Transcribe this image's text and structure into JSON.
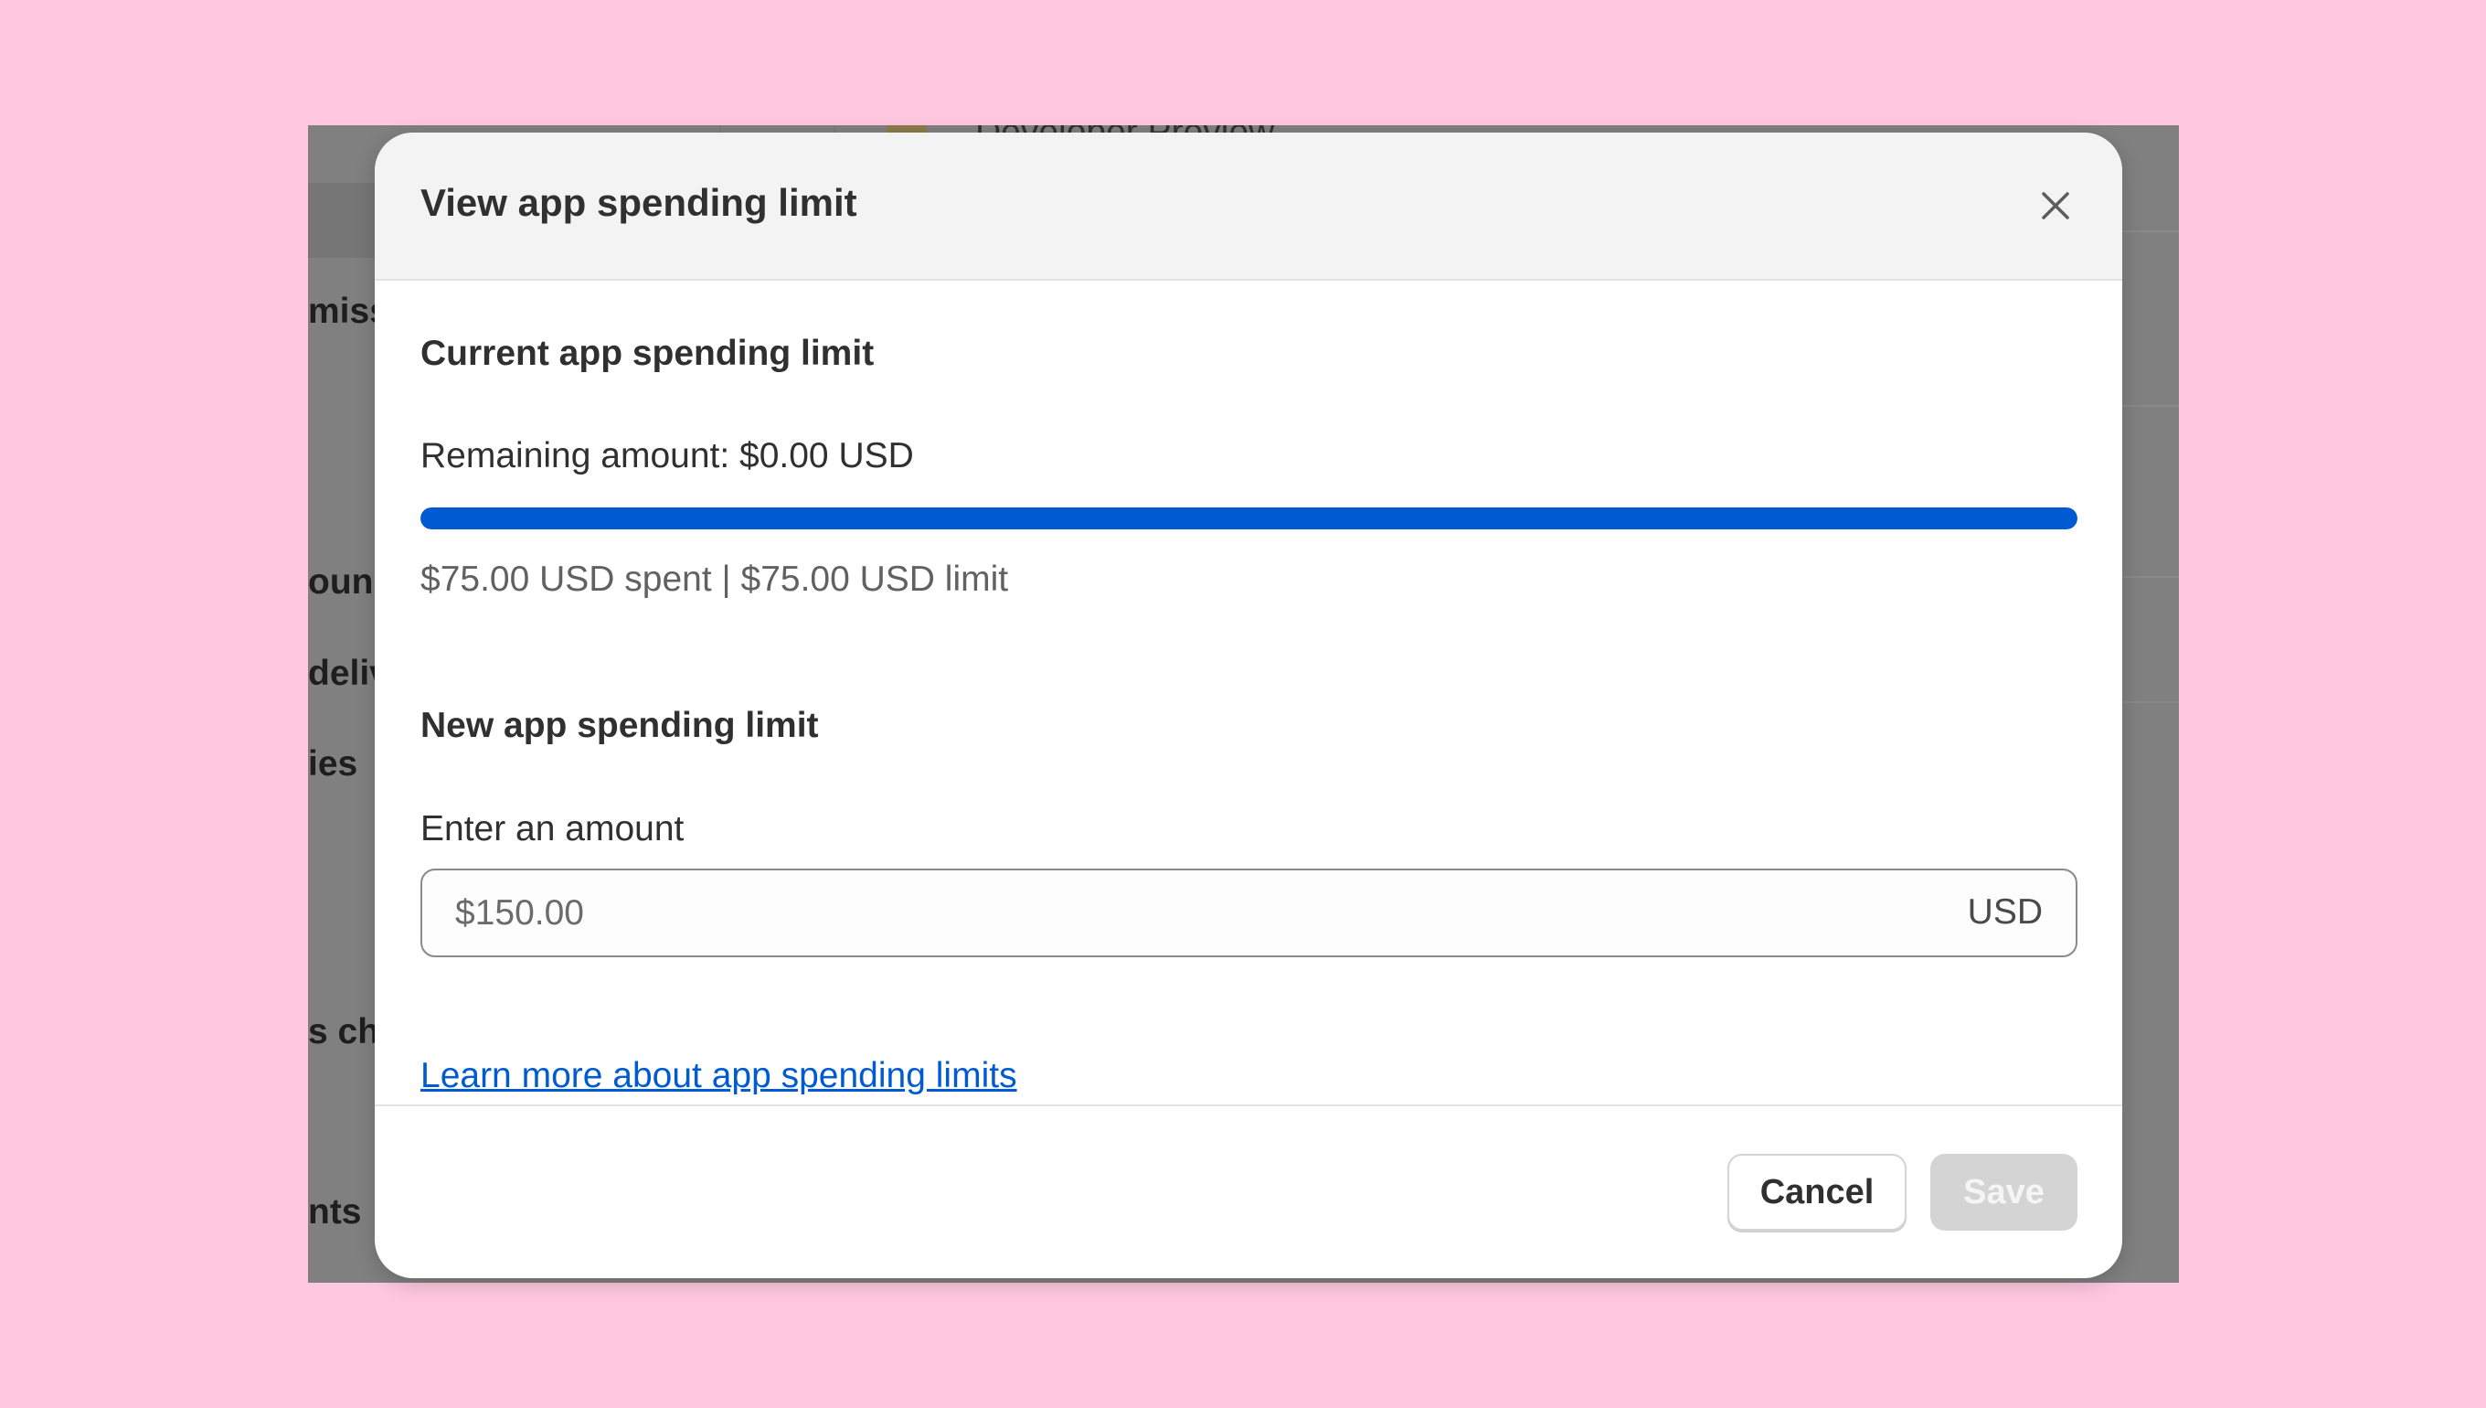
{
  "background_page": {
    "top_text": "Developer Preview",
    "left_fragments": [
      "miss",
      "oun",
      "deliv",
      "ies",
      "s ch",
      "nts"
    ]
  },
  "modal": {
    "title": "View app spending limit",
    "close_icon": "close-icon",
    "current": {
      "heading": "Current app spending limit",
      "remaining": "Remaining amount: $0.00 USD",
      "progress_fraction": 1.0,
      "spent_summary": "$75.00 USD spent | $75.00 USD limit"
    },
    "new_limit": {
      "heading": "New app spending limit",
      "field_label": "Enter an amount",
      "placeholder": "$150.00",
      "value": "",
      "currency": "USD"
    },
    "learn_more": "Learn more about app spending limits",
    "buttons": {
      "cancel": "Cancel",
      "save": "Save"
    }
  },
  "colors": {
    "page_background": "#ffc8e0",
    "overlay": "#808080",
    "accent": "#005bd3",
    "disabled_button": "#d4d4d4"
  }
}
